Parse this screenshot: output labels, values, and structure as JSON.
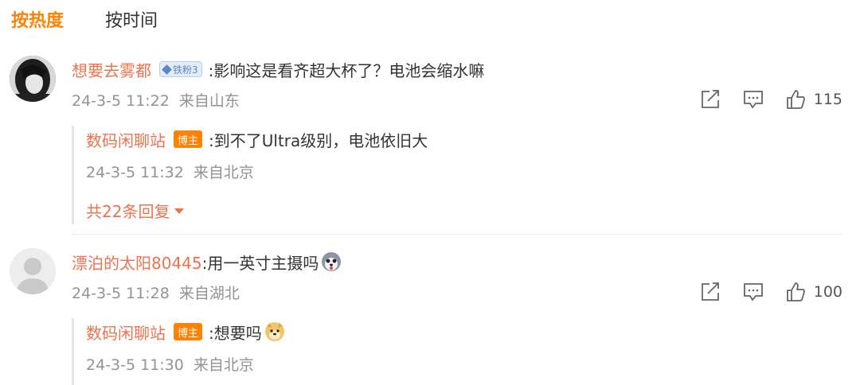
{
  "tabs": [
    {
      "label": "按热度",
      "active": true
    },
    {
      "label": "按时间",
      "active": false
    }
  ],
  "colors": {
    "accent": "#ff8200",
    "username": "#eb7350",
    "meta": "#939393"
  },
  "comments": [
    {
      "username": "想要去雾都",
      "badge": "铁粉3",
      "text": ":影响这是看齐超大杯了？电池会缩水嘛",
      "time": "24-3-5 11:22",
      "location": "来自山东",
      "likes": "115",
      "reply": {
        "username": "数码闲聊站",
        "badge": "博主",
        "text": ":到不了Ultra级别，电池依旧大",
        "time": "24-3-5 11:32",
        "location": "来自北京"
      },
      "more_replies": "共22条回复"
    },
    {
      "username": "漂泊的太阳80445",
      "text": ":用一英寸主摄吗",
      "emoji": "husky-emoji",
      "time": "24-3-5 11:28",
      "location": "来自湖北",
      "likes": "100",
      "reply": {
        "username": "数码闲聊站",
        "badge": "博主",
        "text": ":想要吗",
        "emoji": "doge-emoji",
        "time": "24-3-5 11:30",
        "location": "来自北京"
      }
    }
  ],
  "icons": [
    "share-icon",
    "comment-icon",
    "like-icon",
    "caret-down-icon"
  ]
}
